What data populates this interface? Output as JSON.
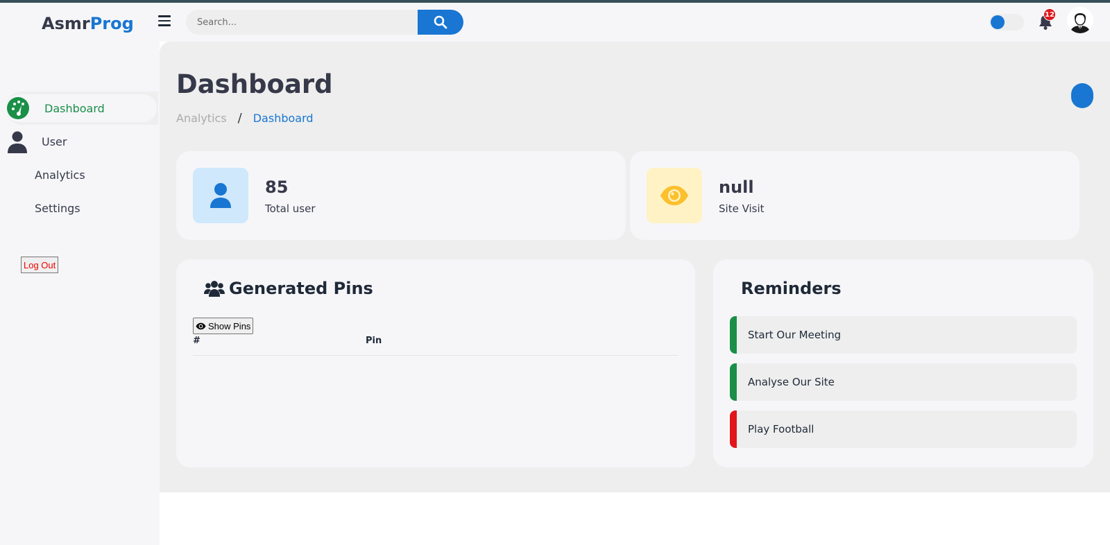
{
  "brand": {
    "part1": "Asmr",
    "part2": "Prog"
  },
  "search": {
    "placeholder": "Search..."
  },
  "notifications": {
    "count": "12"
  },
  "sidebar": {
    "items": [
      {
        "label": "Dashboard",
        "icon": "dashboard-icon",
        "active": true
      },
      {
        "label": "User",
        "icon": "user-icon"
      },
      {
        "label": "Analytics"
      },
      {
        "label": "Settings"
      }
    ],
    "logout_label": "Log Out"
  },
  "header": {
    "title": "Dashboard",
    "breadcrumb": [
      "Analytics",
      "/",
      "Dashboard"
    ]
  },
  "stats": [
    {
      "value": "85",
      "caption": "Total user",
      "icon": "user-icon",
      "color": "#1976d2",
      "bg": "#cfe8fb"
    },
    {
      "value": "null",
      "caption": "Site Visit",
      "icon": "eye-icon",
      "color": "#fbc02d",
      "bg": "#fff2c4"
    }
  ],
  "pins": {
    "title": "Generated Pins",
    "show_label": "Show Pins",
    "columns": [
      "#",
      "Pin"
    ]
  },
  "reminders": {
    "title": "Reminders",
    "items": [
      {
        "label": "Start Our Meeting",
        "color": "#1a8f47"
      },
      {
        "label": "Analyse Our Site",
        "color": "#1a8f47"
      },
      {
        "label": "Play Football",
        "color": "#e0161b"
      }
    ]
  },
  "colors": {
    "primary": "#1976d2",
    "success": "#1a8f47",
    "danger": "#e0161b",
    "dark": "#363949"
  }
}
